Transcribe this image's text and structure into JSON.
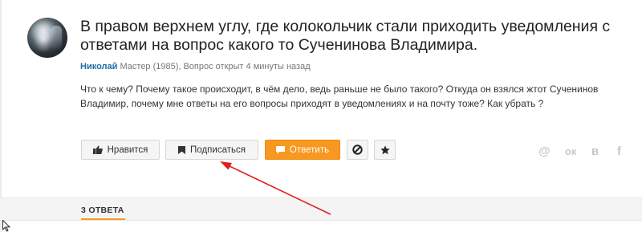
{
  "question": {
    "title": "В правом верхнем углу, где колокольчик стали приходить уведомления с ответами на вопрос какого то Сученинова Владимира.",
    "author": "Николай",
    "author_meta": "Мастер (1985), Вопрос открыт 4 минуты назад",
    "body": "Что к чему? Почему такое происходит, в чём дело, ведь раньше не было такого? Откуда он взялся жтот Сученинов Владимир, почему мне ответы на его вопросы приходят в уведомлениях и на почту тоже? Как убрать ?"
  },
  "actions": {
    "like_label": "Нравится",
    "subscribe_label": "Подписаться",
    "answer_label": "Ответить",
    "block_icon": "block-icon",
    "star_icon": "star-icon"
  },
  "share": {
    "mail_glyph": "@",
    "ok_glyph": "ок",
    "vk_glyph": "в",
    "fb_glyph": "f"
  },
  "answers": {
    "tab_label": "3 ОТВЕТА"
  },
  "colors": {
    "accent": "#f79820",
    "author_link": "#1f6da3",
    "annotation_arrow": "#e02020"
  }
}
